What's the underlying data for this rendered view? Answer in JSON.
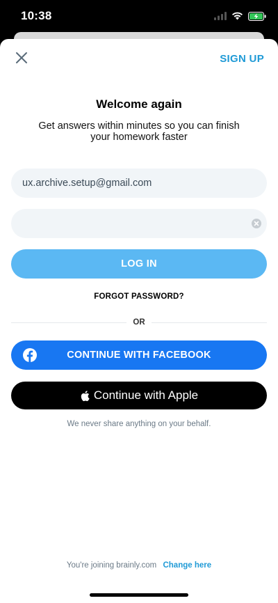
{
  "status_bar": {
    "time": "10:38"
  },
  "header": {
    "signup_label": "SIGN UP"
  },
  "content": {
    "title": "Welcome again",
    "subtitle": "Get answers within minutes so you can finish your homework faster"
  },
  "form": {
    "email_value": "ux.archive.setup@gmail.com",
    "password_value": "",
    "login_label": "LOG IN",
    "forgot_label": "FORGOT PASSWORD?",
    "or_label": "OR"
  },
  "social": {
    "facebook_label": "CONTINUE WITH FACEBOOK",
    "apple_label": "Continue with Apple",
    "disclaimer": "We never share anything on your behalf."
  },
  "footer": {
    "joining_text": "You're joining brainly.com",
    "change_label": "Change here"
  },
  "colors": {
    "accent": "#1f9ad6",
    "login_button": "#5bb8f3",
    "facebook": "#1877f2",
    "apple": "#000000",
    "input_bg": "#f1f5f8"
  },
  "icons": [
    "close-icon",
    "clear-icon",
    "facebook-icon",
    "apple-icon",
    "wifi-icon",
    "signal-icon",
    "battery-icon"
  ]
}
